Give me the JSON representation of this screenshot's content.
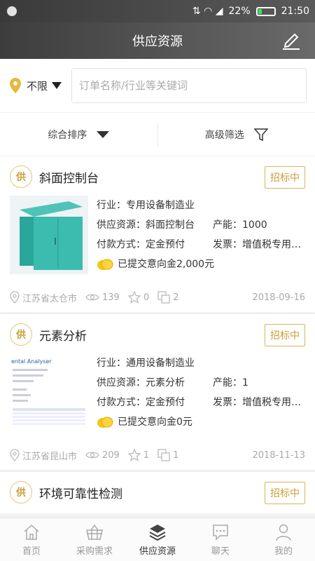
{
  "status_bar": {
    "battery": "22%",
    "time": "21:50"
  },
  "nav": {
    "title": "供应资源"
  },
  "search": {
    "location": "不限",
    "placeholder": "订单名称/行业等关键词"
  },
  "filters": {
    "sort_label": "综合排序",
    "advanced_label": "高级筛选"
  },
  "cards": [
    {
      "brand": "供",
      "title": "斜面控制台",
      "status": "招标中",
      "industry": "行业：专用设备制造业",
      "supply": "供应资源：斜面控制台",
      "capacity": "产能：1000",
      "payment": "付款方式：定金预付",
      "invoice": "发票：增值税专用…",
      "deposit": "已提交意向金2,000元",
      "location": "江苏省太仓市",
      "views": "139",
      "stars": "0",
      "shares": "2",
      "date": "2018-09-16"
    },
    {
      "brand": "供",
      "title": "元素分析",
      "status": "招标中",
      "industry": "行业：通用设备制造业",
      "supply": "供应资源：元素分析",
      "capacity": "产能：1",
      "payment": "付款方式：定金预付",
      "invoice": "发票：增值税专用…",
      "deposit": "已提交意向金0元",
      "location": "江苏省昆山市",
      "views": "209",
      "stars": "1",
      "shares": "1",
      "date": "2018-11-13",
      "thumb_text": "ental Analyser"
    },
    {
      "brand": "供",
      "title": "环境可靠性检测",
      "status": "招标中"
    }
  ],
  "tabs": [
    {
      "label": "首页"
    },
    {
      "label": "采购需求"
    },
    {
      "label": "供应资源"
    },
    {
      "label": "聊天"
    },
    {
      "label": "我的"
    }
  ],
  "colors": {
    "accent": "#c9a03a",
    "location_pin": "#e9b73d",
    "active_tab": "#333333"
  }
}
